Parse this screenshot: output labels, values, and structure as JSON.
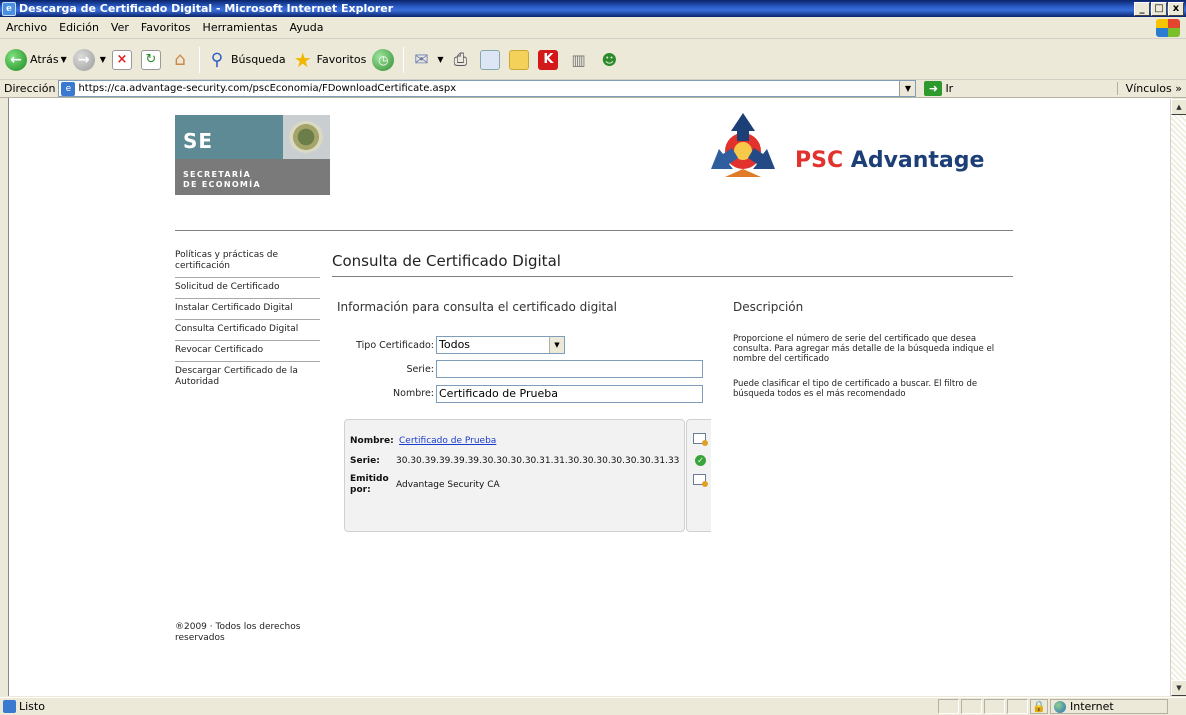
{
  "window": {
    "title": "Descarga de Certificado Digital - Microsoft Internet Explorer",
    "min_label": "_",
    "max_label": "□",
    "close_label": "x"
  },
  "menubar": {
    "items": [
      "Archivo",
      "Edición",
      "Ver",
      "Favoritos",
      "Herramientas",
      "Ayuda"
    ]
  },
  "toolbar": {
    "back_label": "Atrás",
    "search_label": "Búsqueda",
    "favorites_label": "Favoritos"
  },
  "addressbar": {
    "label": "Dirección",
    "url": "https://ca.advantage-security.com/pscEconomia/FDownloadCertificate.aspx",
    "go_label": "Ir",
    "links_label": "Vínculos »"
  },
  "logos": {
    "se_abbrev": "SE",
    "se_line1": "SECRETARÍA",
    "se_line2": "DE ECONOMÍA",
    "psc_red": "PSC",
    "psc_blue": "Advantage"
  },
  "nav": {
    "items": [
      "Políticas y prácticas de certificación",
      "Solicitud de Certificado",
      "Instalar Certificado Digital",
      "Consulta Certificado Digital",
      "Revocar Certificado",
      "Descargar Certificado de la Autoridad"
    ],
    "copyright": "®2009 · Todos los derechos reservados"
  },
  "main": {
    "page_title": "Consulta de Certificado Digital",
    "section_title": "Información para consulta el certificado digital",
    "tipo_label": "Tipo Certificado:",
    "tipo_value": "Todos",
    "serie_label": "Serie:",
    "serie_value": "",
    "nombre_label": "Nombre:",
    "nombre_value": "Certificado de Prueba"
  },
  "description": {
    "title": "Descripción",
    "p1": "Proporcione el número de serie del certificado que desea consulta. Para agregar más detalle de la búsqueda indique el nombre del certificado",
    "p2": "Puede clasificar el tipo de certificado a buscar. El filtro de búsqueda todos es el más recomendado"
  },
  "result": {
    "nombre_label": "Nombre:",
    "nombre_value": "Certificado de Prueba",
    "serie_label": "Serie:",
    "serie_value": "30.30.39.39.39.39.30.30.30.30.31.31.30.30.30.30.30.30.31.33",
    "emitido_label_1": "Emitido",
    "emitido_label_2": "por:",
    "emitido_value": "Advantage Security CA"
  },
  "statusbar": {
    "text": "Listo",
    "zone": "Internet"
  },
  "colors": {
    "titlebar": "#0A246A",
    "chrome": "#ECE9D8",
    "link": "#1a3ccc",
    "psc_red": "#e1322d",
    "psc_blue": "#1c3f77"
  }
}
